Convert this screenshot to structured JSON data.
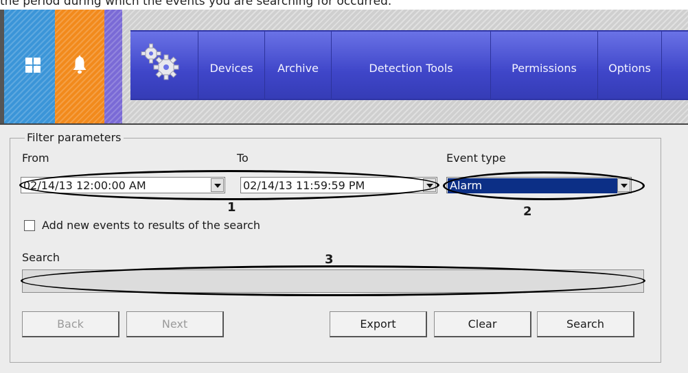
{
  "caption": "the period during which the events you are searching for occurred.",
  "nav": {
    "items": [
      "Devices",
      "Archive",
      "Detection Tools",
      "Permissions",
      "Options"
    ]
  },
  "filter": {
    "title": "Filter parameters",
    "from_label": "From",
    "to_label": "To",
    "event_type_label": "Event type",
    "from_value": "02/14/13 12:00:00 AM",
    "to_value": "02/14/13 11:59:59 PM",
    "event_type_value": "Alarm",
    "add_new_events_label": "Add new events to results of the search",
    "search_label": "Search",
    "search_value": ""
  },
  "callouts": [
    "1",
    "2",
    "3"
  ],
  "buttons": {
    "back": "Back",
    "next": "Next",
    "export": "Export",
    "clear": "Clear",
    "search": "Search"
  }
}
